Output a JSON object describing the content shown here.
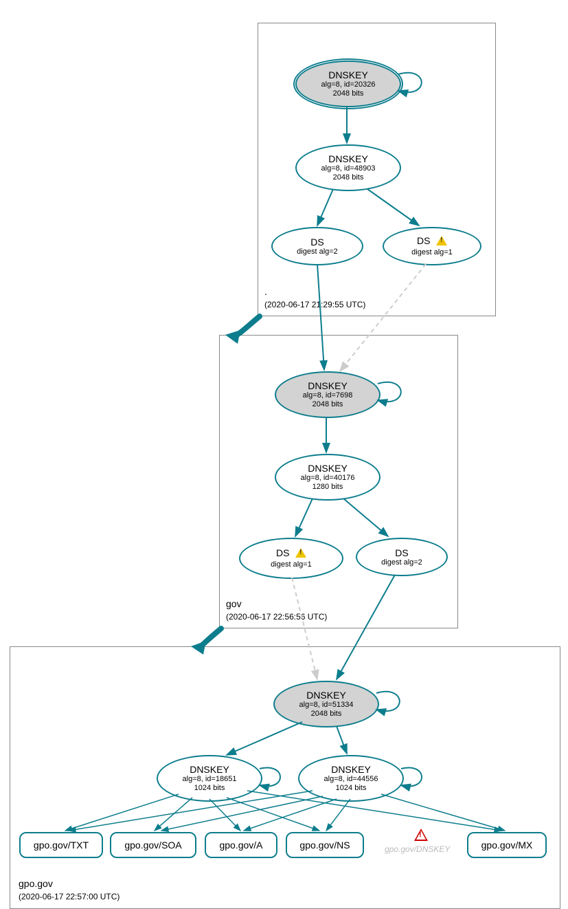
{
  "chart_data": {
    "type": "graph",
    "zones": [
      {
        "name": ".",
        "timestamp": "(2020-06-17 21:29:55 UTC)",
        "nodes": [
          {
            "id": "root-ksk",
            "type": "DNSKEY",
            "alg": "alg=8, id=20326",
            "bits": "2048 bits",
            "ksk": true,
            "trust_anchor": true
          },
          {
            "id": "root-zsk",
            "type": "DNSKEY",
            "alg": "alg=8, id=48903",
            "bits": "2048 bits"
          },
          {
            "id": "root-ds2",
            "type": "DS",
            "alg": "digest alg=2"
          },
          {
            "id": "root-ds1",
            "type": "DS",
            "alg": "digest alg=1",
            "warning": true
          }
        ]
      },
      {
        "name": "gov",
        "timestamp": "(2020-06-17 22:56:56 UTC)",
        "nodes": [
          {
            "id": "gov-ksk",
            "type": "DNSKEY",
            "alg": "alg=8, id=7698",
            "bits": "2048 bits",
            "ksk": true
          },
          {
            "id": "gov-zsk",
            "type": "DNSKEY",
            "alg": "alg=8, id=40176",
            "bits": "1280 bits"
          },
          {
            "id": "gov-ds1",
            "type": "DS",
            "alg": "digest alg=1",
            "warning": true
          },
          {
            "id": "gov-ds2",
            "type": "DS",
            "alg": "digest alg=2"
          }
        ]
      },
      {
        "name": "gpo.gov",
        "timestamp": "(2020-06-17 22:57:00 UTC)",
        "nodes": [
          {
            "id": "gpo-ksk",
            "type": "DNSKEY",
            "alg": "alg=8, id=51334",
            "bits": "2048 bits",
            "ksk": true
          },
          {
            "id": "gpo-zsk1",
            "type": "DNSKEY",
            "alg": "alg=8, id=18651",
            "bits": "1024 bits"
          },
          {
            "id": "gpo-zsk2",
            "type": "DNSKEY",
            "alg": "alg=8, id=44556",
            "bits": "1024 bits"
          }
        ],
        "leaves": [
          "gpo.gov/TXT",
          "gpo.gov/SOA",
          "gpo.gov/A",
          "gpo.gov/NS",
          "gpo.gov/MX"
        ],
        "ghost_leaf": "gpo.gov/DNSKEY",
        "ghost_error": true
      }
    ],
    "edges": [
      {
        "from": "root-ksk",
        "to": "root-ksk",
        "style": "self"
      },
      {
        "from": "root-ksk",
        "to": "root-zsk",
        "style": "solid"
      },
      {
        "from": "root-zsk",
        "to": "root-ds2",
        "style": "solid"
      },
      {
        "from": "root-zsk",
        "to": "root-ds1",
        "style": "solid"
      },
      {
        "from": "root-ds2",
        "to": "gov-ksk",
        "style": "solid"
      },
      {
        "from": "root-ds1",
        "to": "gov-ksk",
        "style": "dashed-gray"
      },
      {
        "from": "gov-ksk",
        "to": "gov-ksk",
        "style": "self"
      },
      {
        "from": "gov-ksk",
        "to": "gov-zsk",
        "style": "solid"
      },
      {
        "from": "gov-zsk",
        "to": "gov-ds1",
        "style": "solid"
      },
      {
        "from": "gov-zsk",
        "to": "gov-ds2",
        "style": "solid"
      },
      {
        "from": "gov-ds1",
        "to": "gpo-ksk",
        "style": "dashed-gray"
      },
      {
        "from": "gov-ds2",
        "to": "gpo-ksk",
        "style": "solid"
      },
      {
        "from": "gpo-ksk",
        "to": "gpo-ksk",
        "style": "self"
      },
      {
        "from": "gpo-ksk",
        "to": "gpo-zsk1",
        "style": "solid"
      },
      {
        "from": "gpo-ksk",
        "to": "gpo-zsk2",
        "style": "solid"
      },
      {
        "from": "gpo-zsk1",
        "to": "gpo-zsk1",
        "style": "self"
      },
      {
        "from": "gpo-zsk2",
        "to": "gpo-zsk2",
        "style": "self"
      },
      {
        "from": "gpo-zsk1",
        "to": "leaves",
        "style": "solid"
      },
      {
        "from": "gpo-zsk2",
        "to": "leaves",
        "style": "solid"
      }
    ]
  }
}
